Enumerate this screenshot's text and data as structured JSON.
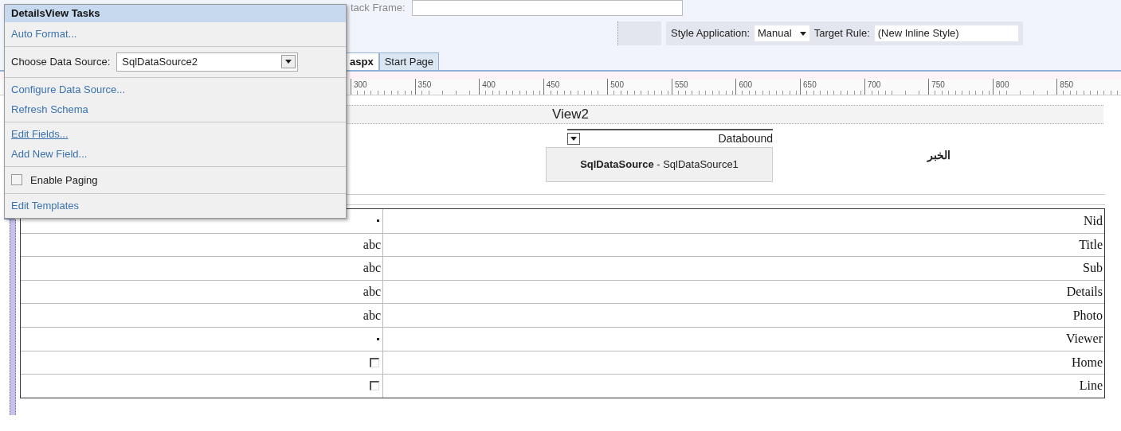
{
  "toolbar": {
    "stack_frame_label": "tack Frame:",
    "style_application_label": "Style Application:",
    "style_application_value": "Manual",
    "target_rule_label": "Target Rule:",
    "target_rule_value": "(New Inline Style)"
  },
  "tabs": [
    {
      "label": "aspx",
      "selected": true
    },
    {
      "label": "Start Page",
      "selected": false
    }
  ],
  "ruler": {
    "labels": [
      "300",
      "350",
      "400",
      "450",
      "500",
      "550",
      "600",
      "650",
      "700",
      "750",
      "800",
      "850"
    ]
  },
  "design": {
    "view_title": "View2",
    "databound_label": "Databound",
    "datasource_control": "**SqlDataSource** - SqlDataSource1",
    "arabic_label": "الخبر",
    "details_rows": [
      {
        "kind": "dot",
        "value": "",
        "field": "Nid"
      },
      {
        "kind": "text",
        "value": "abc",
        "field": "Title"
      },
      {
        "kind": "text",
        "value": "abc",
        "field": "Sub"
      },
      {
        "kind": "text",
        "value": "abc",
        "field": "Details"
      },
      {
        "kind": "text",
        "value": "abc",
        "field": "Photo"
      },
      {
        "kind": "dot",
        "value": "",
        "field": "Viewer"
      },
      {
        "kind": "checkbox",
        "value": "",
        "field": "Home"
      },
      {
        "kind": "checkbox",
        "value": "",
        "field": "Line"
      }
    ]
  },
  "tasks_popup": {
    "title": "DetailsView Tasks",
    "groups": [
      [
        {
          "kind": "link",
          "label": "Auto Format...",
          "hovered": false
        }
      ],
      [
        {
          "kind": "dropdown",
          "label": "Choose Data Source:",
          "value": "SqlDataSource2"
        }
      ],
      [
        {
          "kind": "link",
          "label": "Configure Data Source...",
          "hovered": false
        },
        {
          "kind": "link",
          "label": "Refresh Schema",
          "hovered": false
        }
      ],
      [
        {
          "kind": "link",
          "label": "Edit Fields...",
          "hovered": true
        },
        {
          "kind": "link",
          "label": "Add New Field...",
          "hovered": false
        }
      ],
      [
        {
          "kind": "checkbox",
          "label": "Enable Paging",
          "checked": false
        }
      ],
      [
        {
          "kind": "link",
          "label": "Edit Templates",
          "hovered": false
        }
      ]
    ]
  }
}
